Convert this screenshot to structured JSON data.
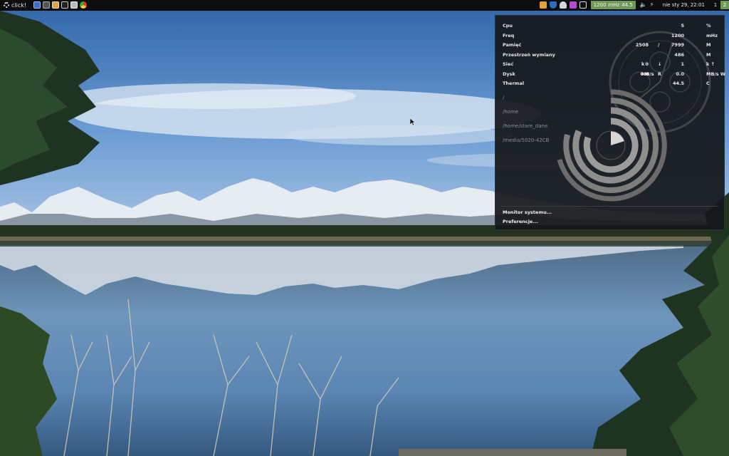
{
  "panel": {
    "menu_label": "click!",
    "launchers": [
      "files-icon",
      "terminal-icon",
      "text-editor-icon",
      "tray-window-icon",
      "calculator-icon",
      "chrome-icon"
    ],
    "tray_icons": [
      "clipboard-icon",
      "shield-icon",
      "network-icon",
      "chat-icon",
      "mail-icon"
    ],
    "sysmon": {
      "freq": "1200",
      "freq_unit": "mHz",
      "temp": "44.5"
    },
    "clock": "nie sty 29, 22:01",
    "workspaces": [
      "1",
      "2"
    ],
    "active_workspace": "2"
  },
  "popup": {
    "stats": [
      {
        "name": "Cpu",
        "v1": "",
        "u1": "",
        "sep": "",
        "v2": "5",
        "u2": "%"
      },
      {
        "name": "Freq",
        "v1": "",
        "u1": "",
        "sep": "",
        "v2": "1200",
        "u2": "mHz"
      },
      {
        "name": "Pamięć",
        "v1": "2508",
        "u1": "",
        "sep": "/",
        "v2": "7999",
        "u2": "M"
      },
      {
        "name": "Przestrzeń wymiany",
        "v1": "",
        "u1": "",
        "sep": "",
        "v2": "486",
        "u2": "M"
      },
      {
        "name": "Sieć",
        "v1": "0",
        "u1": "k",
        "sep": "↓",
        "v2": "1",
        "u2": "k ↑"
      },
      {
        "name": "Dysk",
        "v1": "0.0",
        "u1": "MB/s",
        "sep": "R",
        "v2": "0.0",
        "u2": "MB/s W"
      },
      {
        "name": "Thermal",
        "v1": "",
        "u1": "",
        "sep": "",
        "v2": "44.5",
        "u2": "C"
      }
    ],
    "disks": [
      "/",
      "/home",
      "/home/stare_dane",
      "/media/5020-42CB"
    ],
    "menu": {
      "monitor": "Monitor systemu...",
      "prefs": "Preferencje..."
    }
  },
  "colors": {
    "panel_bg": "#0d0d0d",
    "accent_green": "#6f9a5a",
    "popup_bg": "#16181b"
  }
}
